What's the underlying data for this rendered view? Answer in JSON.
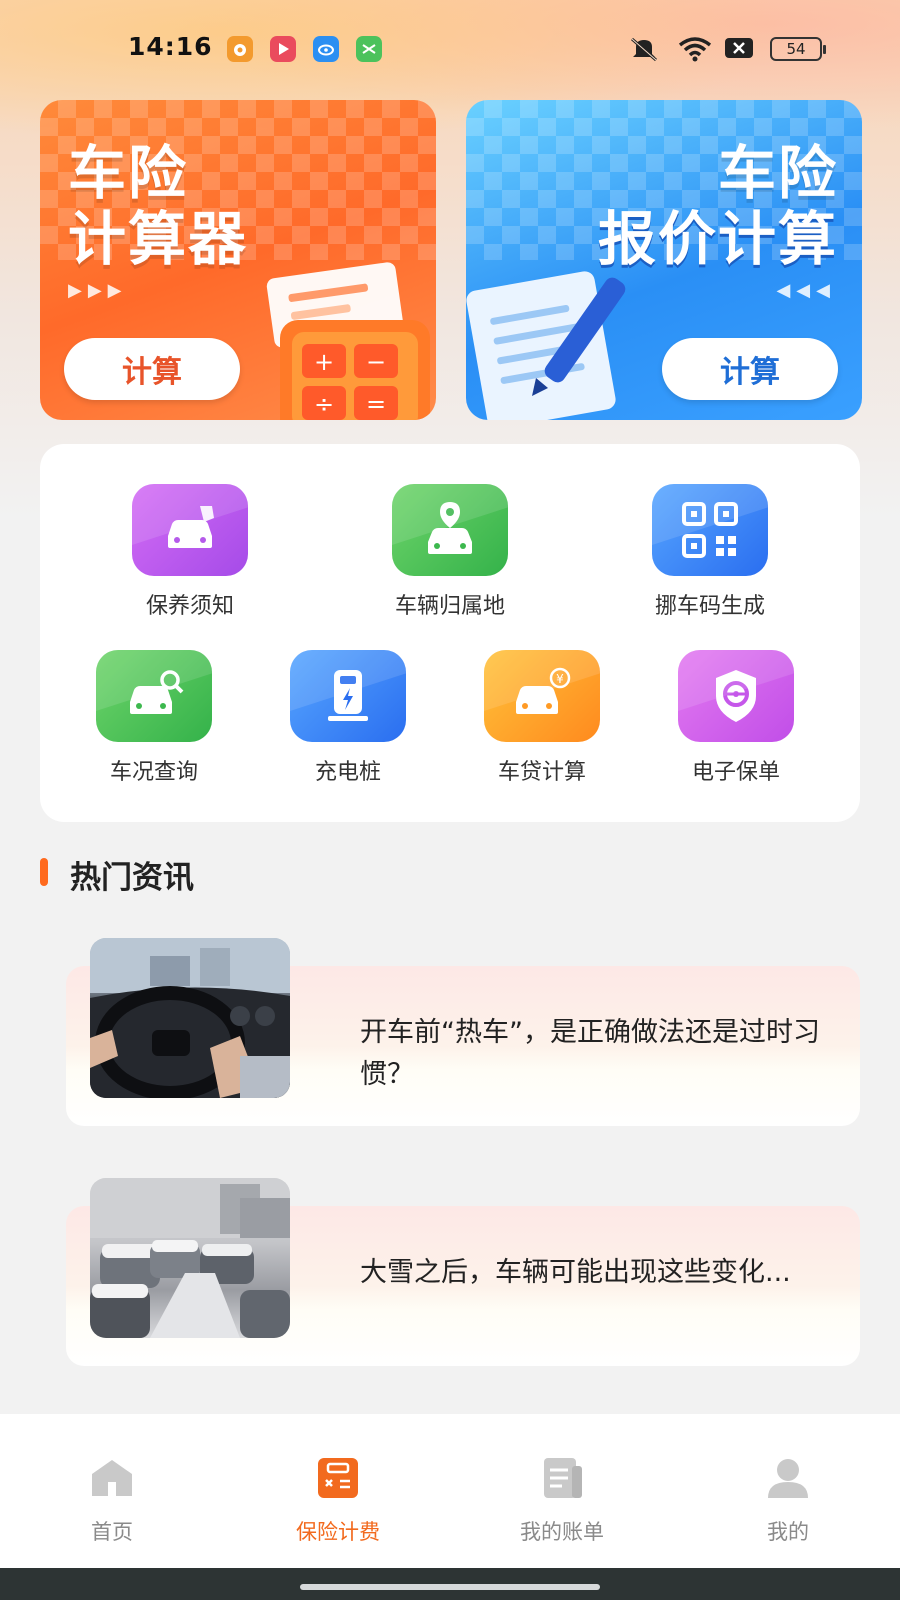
{
  "status_bar": {
    "time": "14:16",
    "battery": "54",
    "notification_icons": [
      "weibo-icon",
      "video-icon",
      "cloud-icon",
      "app-icon"
    ],
    "system_icons": [
      "mute-icon",
      "wifi-icon",
      "sim-off-icon",
      "battery-icon"
    ]
  },
  "banners": [
    {
      "title_line1": "车险",
      "title_line2": "计算器",
      "button": "计算",
      "color": "#ff6a2a"
    },
    {
      "title_line1": "车险",
      "title_line2": "报价计算",
      "button": "计算",
      "color": "#2a8ff5"
    }
  ],
  "features_row1": [
    {
      "label": "保养须知",
      "icon": "car-maintenance-icon",
      "color": "purple"
    },
    {
      "label": "车辆归属地",
      "icon": "car-location-icon",
      "color": "green"
    },
    {
      "label": "挪车码生成",
      "icon": "qr-code-icon",
      "color": "blue"
    }
  ],
  "features_row2": [
    {
      "label": "车况查询",
      "icon": "car-search-icon",
      "color": "green"
    },
    {
      "label": "充电桩",
      "icon": "charging-pile-icon",
      "color": "blue"
    },
    {
      "label": "车贷计算",
      "icon": "car-loan-icon",
      "color": "orange"
    },
    {
      "label": "电子保单",
      "icon": "shield-icon",
      "color": "magenta"
    }
  ],
  "news_section": {
    "title": "热门资讯",
    "items": [
      {
        "title": "开车前“热车”，是正确做法还是过时习惯？"
      },
      {
        "title": "大雪之后，车辆可能出现这些变化..."
      }
    ]
  },
  "tab_bar": {
    "active_index": 1,
    "accent_color": "#f26a1e",
    "tabs": [
      {
        "label": "首页",
        "icon": "home-icon"
      },
      {
        "label": "保险计费",
        "icon": "calculator-icon"
      },
      {
        "label": "我的账单",
        "icon": "bill-icon"
      },
      {
        "label": "我的",
        "icon": "user-icon"
      }
    ]
  }
}
